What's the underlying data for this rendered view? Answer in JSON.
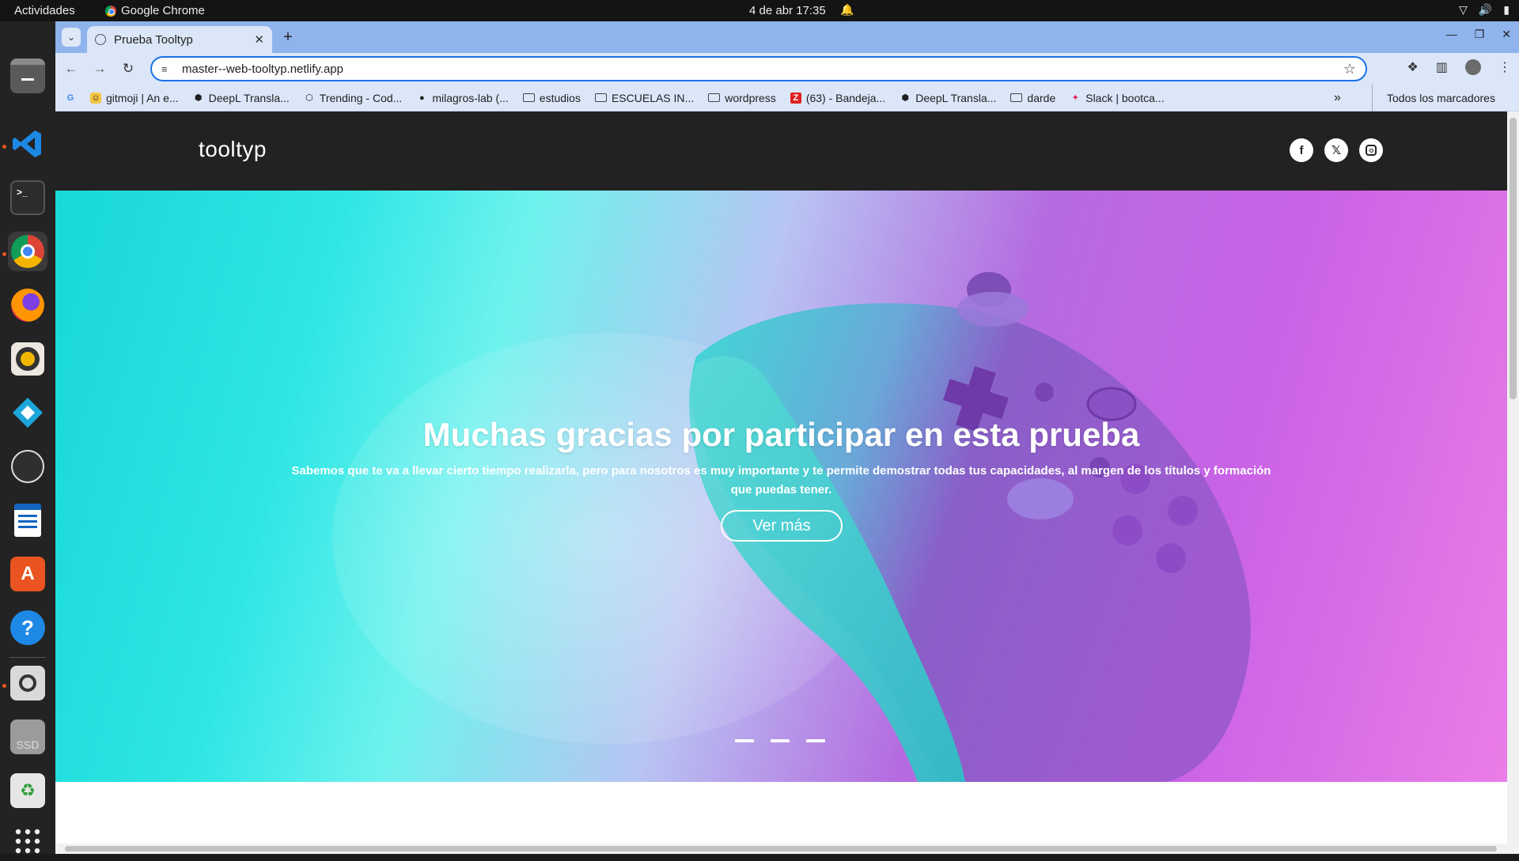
{
  "system_bar": {
    "activities": "Actividades",
    "app_name": "Google Chrome",
    "clock": "4 de abr  17:35"
  },
  "dock": {
    "items": [
      "files-icon",
      "vscode-icon",
      "terminal-icon",
      "chrome-icon",
      "firefox-icon",
      "rhythmbox-icon",
      "kodi-icon",
      "obs-icon",
      "writer-icon",
      "app-center-icon",
      "help-icon",
      "magnifier-icon",
      "ssd-icon",
      "trash-icon",
      "apps-grid-icon"
    ],
    "ssd_label": "SSD"
  },
  "browser": {
    "tab_title": "Prueba Tooltyp",
    "url": "master--web-tooltyp.netlify.app",
    "bookmarks": [
      {
        "label": "gitmoji | An e...",
        "icon": "gitmoji-icon"
      },
      {
        "label": "DeepL Transla...",
        "icon": "deepl-icon"
      },
      {
        "label": "Trending - Cod...",
        "icon": "codepen-icon"
      },
      {
        "label": "milagros-lab (...",
        "icon": "github-icon"
      },
      {
        "label": "estudios",
        "icon": "folder-icon"
      },
      {
        "label": "ESCUELAS IN...",
        "icon": "folder-icon"
      },
      {
        "label": "wordpress",
        "icon": "folder-icon"
      },
      {
        "label": "(63) - Bandeja...",
        "icon": "zoho-icon"
      },
      {
        "label": "DeepL Transla...",
        "icon": "deepl-icon"
      },
      {
        "label": "darde",
        "icon": "folder-icon"
      },
      {
        "label": "Slack | bootca...",
        "icon": "slack-icon"
      }
    ],
    "all_bookmarks": "Todos los marcadores"
  },
  "site": {
    "logo": "tooltyp",
    "socials": [
      "facebook-icon",
      "twitter-icon",
      "instagram-icon"
    ],
    "hero": {
      "title": "Muchas gracias por participar en esta prueba",
      "subtitle": "Sabemos que te va a llevar cierto tiempo realizarla, pero para nosotros es muy importante y te permite demostrar todas tus capacidades, al margen de los títulos y formación que puedas tener.",
      "button": "Ver más",
      "slides": 3
    }
  }
}
